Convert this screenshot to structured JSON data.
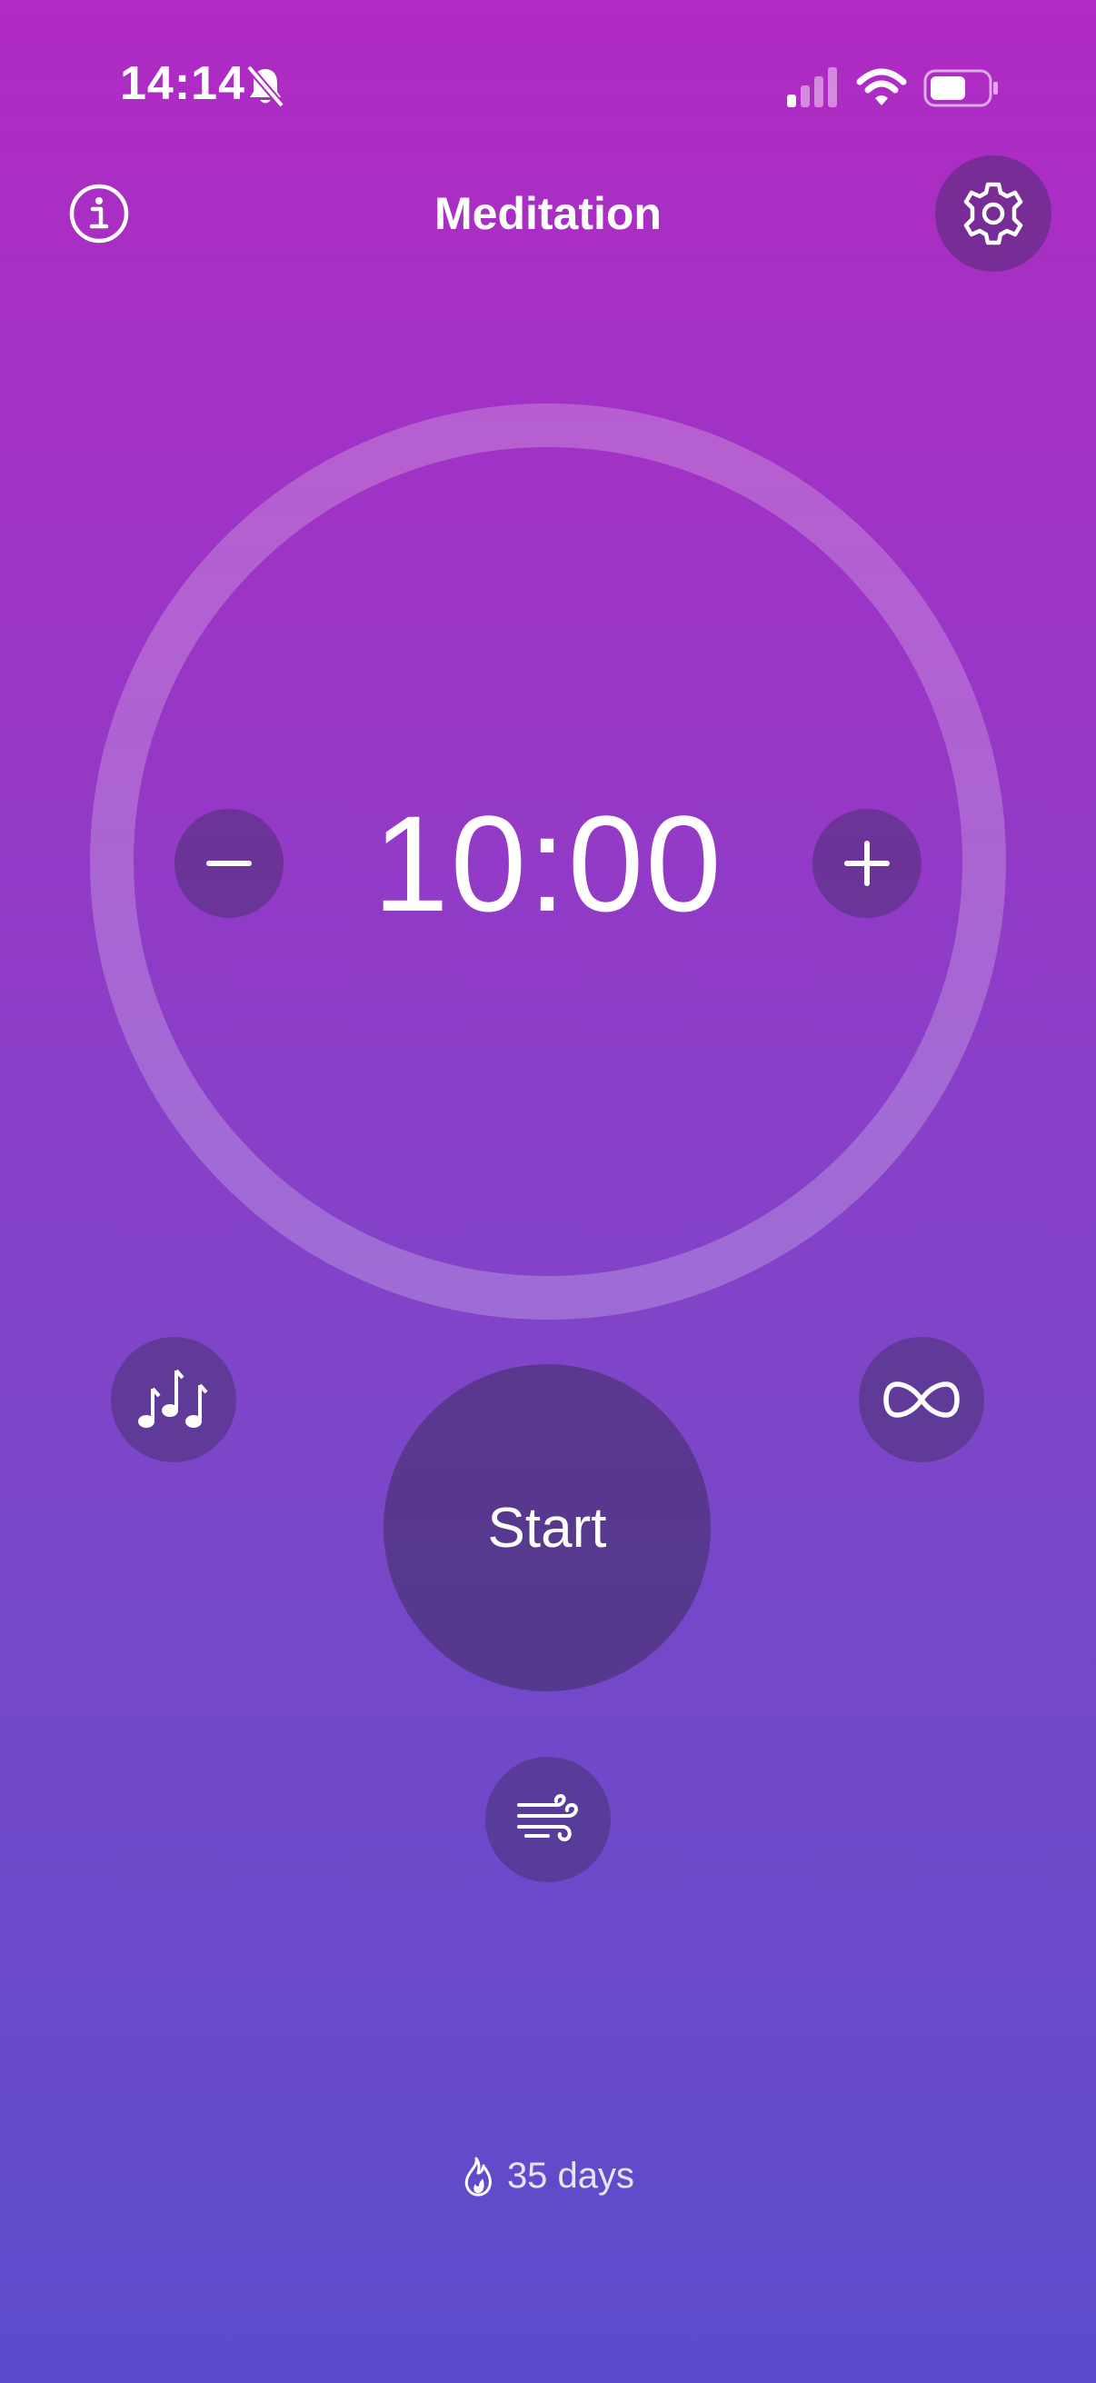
{
  "status_bar": {
    "time": "14:14",
    "icons": [
      "bell-slash-icon",
      "cellular-signal-icon",
      "wifi-icon",
      "battery-icon"
    ]
  },
  "header": {
    "title": "Meditation",
    "info_icon": "info-circle-icon",
    "settings_icon": "gear-icon"
  },
  "timer": {
    "display": "10:00",
    "decrement_icon": "minus-icon",
    "increment_icon": "plus-icon"
  },
  "controls": {
    "music_icon": "music-notes-icon",
    "repeat_icon": "infinity-icon",
    "start_label": "Start",
    "breathing_icon": "wind-icon"
  },
  "streak": {
    "icon": "flame-icon",
    "label": "35 days"
  },
  "colors": {
    "gradient_top": "#b02ac3",
    "gradient_bottom": "#5b4ccb",
    "button_fill": "#5a3f8c",
    "text": "#ffffff"
  }
}
